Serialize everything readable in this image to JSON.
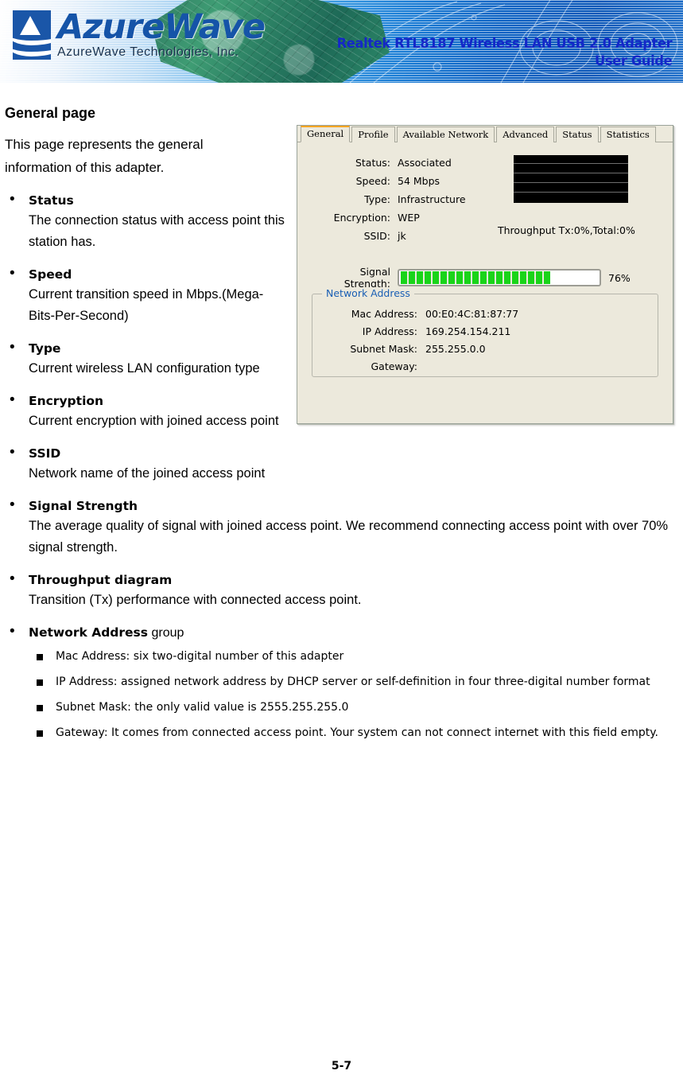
{
  "header": {
    "logo_word": "AzureWave",
    "logo_sub": "AzureWave  Technologies,  Inc.",
    "title_line1": "Realtek RTL8187 Wireless LAN USB 2.0 Adapter",
    "title_line2": "User Guide",
    "title_color": "#1427c8",
    "logo_color": "#1554a8"
  },
  "doc": {
    "page_heading": "General page",
    "intro": "This page represents the general information of this adapter.",
    "bullets": [
      {
        "title": "Status",
        "body": "The connection status with access point this station has."
      },
      {
        "title": "Speed",
        "body": "Current transition speed in Mbps.(Mega-Bits-Per-Second)"
      },
      {
        "title": "Type",
        "body": "Current wireless LAN configuration type"
      },
      {
        "title": "Encryption",
        "body": "Current encryption with joined access point"
      },
      {
        "title": "SSID",
        "body": "Network name of the joined access point"
      },
      {
        "title": "Signal Strength",
        "body": "The average quality of signal with joined access point. We recommend connecting access point with over 70% signal strength."
      },
      {
        "title": "Throughput diagram",
        "body": "Transition (Tx) performance with connected access point."
      }
    ],
    "group_bullet_title": "Network Address",
    "group_bullet_suffix": " group",
    "sub_items": [
      "Mac Address: six two-digital number of this adapter",
      "IP Address: assigned network address by DHCP server or self-definition in four three-digital number format",
      "Subnet Mask: the only valid value is 2555.255.255.0",
      "Gateway: It comes from connected access point. Your system can not connect internet with this field empty."
    ],
    "page_number": "5-7"
  },
  "screenshot": {
    "tabs": [
      {
        "label": "General",
        "active": true
      },
      {
        "label": "Profile",
        "active": false
      },
      {
        "label": "Available Network",
        "active": false
      },
      {
        "label": "Advanced",
        "active": false
      },
      {
        "label": "Status",
        "active": false
      },
      {
        "label": "Statistics",
        "active": false
      }
    ],
    "active_tab_color": "#F5A623",
    "panel_bg": "#ECE9DC",
    "info": [
      {
        "label": "Status:",
        "value": "Associated"
      },
      {
        "label": "Speed:",
        "value": "54 Mbps"
      },
      {
        "label": "Type:",
        "value": "Infrastructure"
      },
      {
        "label": "Encryption:",
        "value": "WEP"
      },
      {
        "label": "SSID:",
        "value": "jk"
      }
    ],
    "throughput_label": "Throughput  Tx:0%,Total:0%",
    "signal": {
      "label": "Signal Strength:",
      "percent_text": "76%",
      "percent": 76,
      "bar_color": "#19D419"
    },
    "network_group": {
      "legend": "Network Address",
      "legend_color": "#1a5fb4",
      "rows": [
        {
          "label": "Mac Address:",
          "value": "00:E0:4C:81:87:77"
        },
        {
          "label": "IP Address:",
          "value": "169.254.154.211"
        },
        {
          "label": "Subnet Mask:",
          "value": "255.255.0.0"
        },
        {
          "label": "Gateway:",
          "value": ""
        }
      ]
    }
  }
}
